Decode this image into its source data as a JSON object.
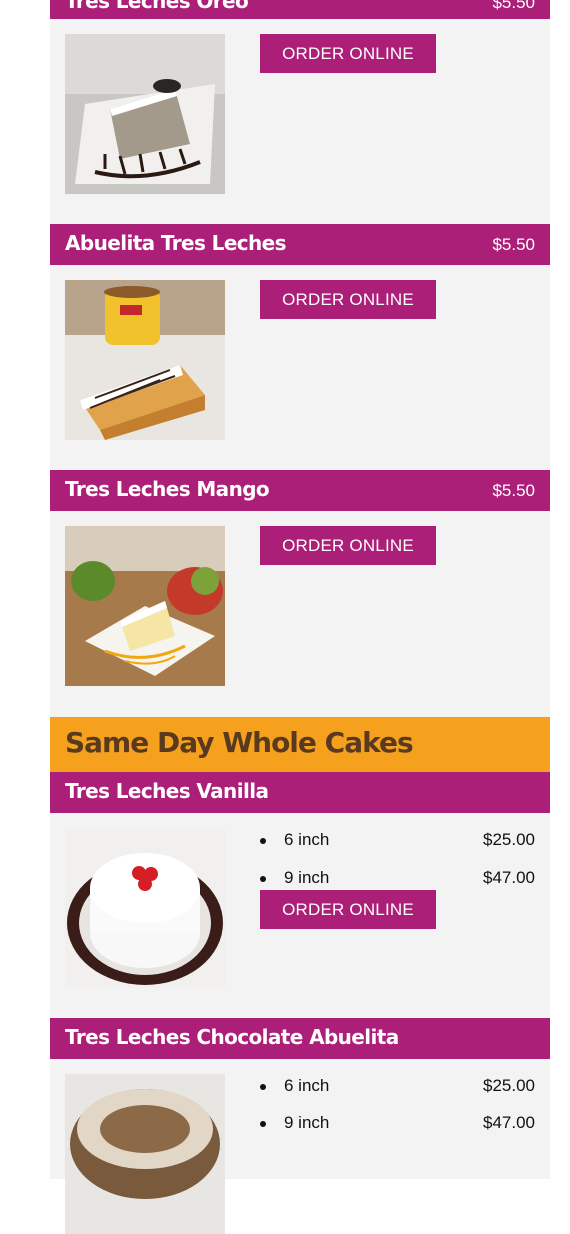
{
  "order_label": "ORDER ONLINE",
  "colors": {
    "header": "#ab1f78",
    "banner": "#f6a11e",
    "card": "#f3f3f3",
    "banner_text": "#5a3a1f"
  },
  "items": [
    {
      "name": "Tres Leches Oreo",
      "price": "$5.50",
      "image": "oreo-cake-slice"
    },
    {
      "name": "Abuelita Tres Leches",
      "price": "$5.50",
      "image": "abuelita-cake-slice"
    },
    {
      "name": "Tres Leches Mango",
      "price": "$5.50",
      "image": "mango-cake-slice"
    }
  ],
  "section": {
    "title": "Same Day Whole Cakes"
  },
  "whole_cakes": [
    {
      "name": "Tres Leches Vanilla",
      "image": "vanilla-whole-cake",
      "sizes": [
        {
          "label": "6 inch",
          "price": "$25.00"
        },
        {
          "label": "9 inch",
          "price": "$47.00"
        }
      ]
    },
    {
      "name": "Tres Leches Chocolate Abuelita",
      "image": "chocolate-whole-cake",
      "sizes": [
        {
          "label": "6 inch",
          "price": "$25.00"
        },
        {
          "label": "9 inch",
          "price": "$47.00"
        }
      ]
    }
  ]
}
